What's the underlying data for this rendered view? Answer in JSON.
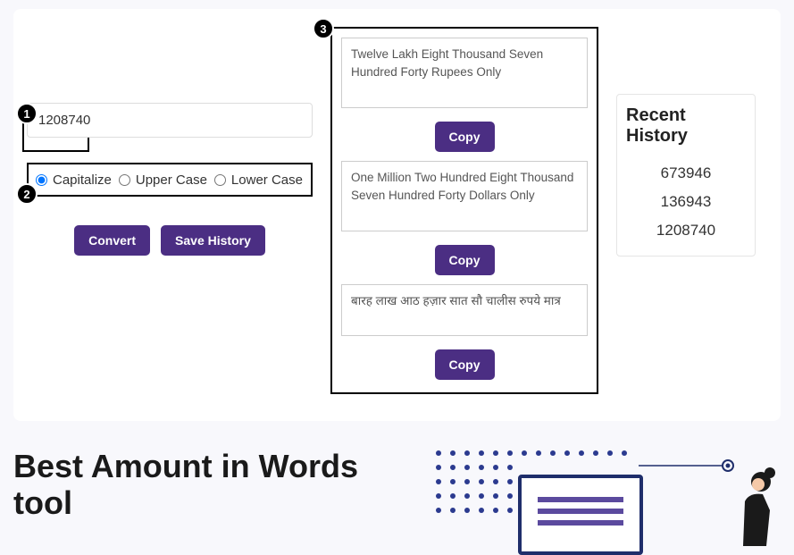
{
  "input": {
    "number": "1208740"
  },
  "case_options": {
    "capitalize": "Capitalize",
    "upper": "Upper Case",
    "lower": "Lower Case"
  },
  "buttons": {
    "convert": "Convert",
    "save_history": "Save History",
    "copy": "Copy"
  },
  "outputs": [
    "Twelve Lakh Eight Thousand Seven Hundred Forty Rupees Only",
    "One Million Two Hundred Eight Thousand Seven Hundred Forty Dollars Only",
    "बारह लाख आठ हज़ार सात सौ चालीस रुपये मात्र"
  ],
  "history": {
    "title": "Recent History",
    "items": [
      "673946",
      "136943",
      "1208740"
    ]
  },
  "heading": "Best Amount in Words tool",
  "badges": {
    "b1": "1",
    "b2": "2",
    "b3": "3"
  }
}
